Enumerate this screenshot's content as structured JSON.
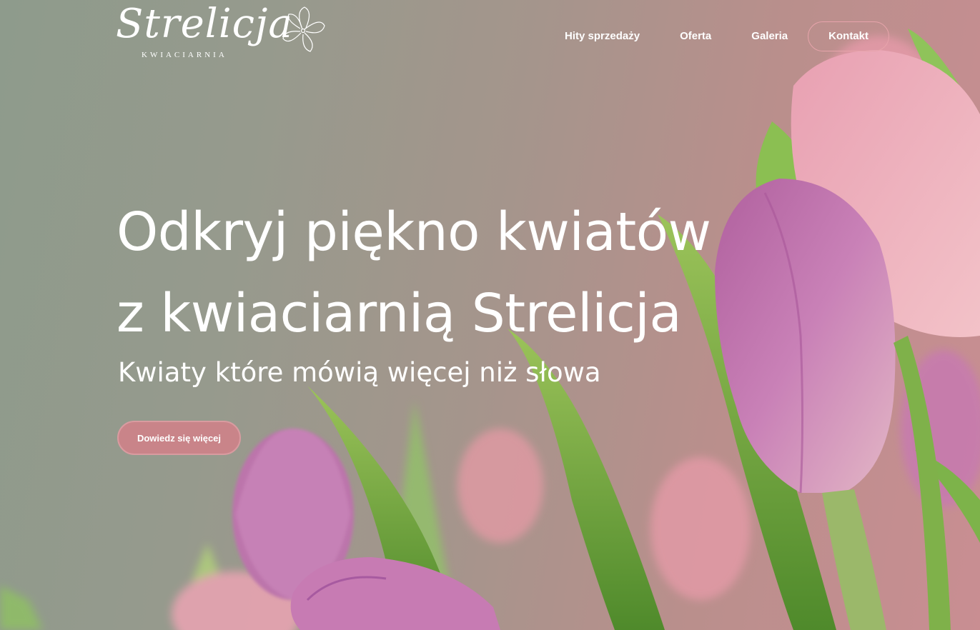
{
  "logo": {
    "script": "Strelicja",
    "subtitle": "KWIACIARNIA",
    "icon": "flower-icon"
  },
  "nav": {
    "items": [
      {
        "label": "Hity sprzedaży"
      },
      {
        "label": "Oferta"
      },
      {
        "label": "Galeria"
      }
    ],
    "contact_label": "Kontakt"
  },
  "hero": {
    "headline_line1": "Odkryj piękno kwiatów",
    "headline_line2": "z kwiaciarnią Strelicja",
    "subheadline": "Kwiaty które mówią więcej niż słowa",
    "cta_label": "Dowiedz się więcej",
    "background": "pink and purple tulips photo"
  },
  "colors": {
    "accent": "#c98489",
    "accent_border": "#e7a4ab",
    "text": "#ffffff"
  }
}
